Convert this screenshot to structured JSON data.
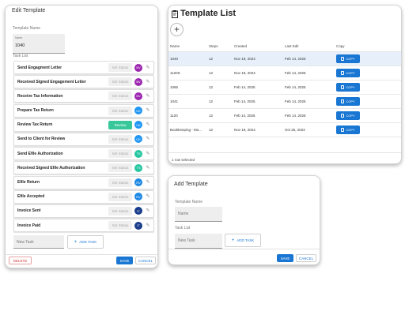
{
  "edit_template": {
    "title": "Edit Template",
    "template_name_label": "Template Name",
    "name_field_label": "Name",
    "name_value": "1040",
    "task_list_label": "Task List",
    "tasks": [
      {
        "name": "Send Engagment Letter",
        "status": "Set Status",
        "avatar": "BV",
        "color": "#9c27b0"
      },
      {
        "name": "Received Signed Engagement Letter",
        "status": "Set Status",
        "avatar": "BV",
        "color": "#9c27b0"
      },
      {
        "name": "Receive Tax Information",
        "status": "Set Status",
        "avatar": "BV",
        "color": "#9c27b0"
      },
      {
        "name": "Prepare Tax Return",
        "status": "Set Status",
        "avatar": "CK",
        "color": "#2196f3"
      },
      {
        "name": "Review Tax Return",
        "status": "Review",
        "avatar": "CK",
        "color": "#2196f3"
      },
      {
        "name": "Send to Client for Review",
        "status": "Set Status",
        "avatar": "CK",
        "color": "#2196f3"
      },
      {
        "name": "Send Efile Authorization",
        "status": "Set Status",
        "avatar": "TS",
        "color": "#26c6a0"
      },
      {
        "name": "Received Signed Efile Authorization",
        "status": "Set Status",
        "avatar": "TS",
        "color": "#26c6a0"
      },
      {
        "name": "Efile Return",
        "status": "Set Status",
        "avatar": "RV",
        "color": "#1e88e5"
      },
      {
        "name": "Efile Accepted",
        "status": "Set Status",
        "avatar": "RV",
        "color": "#1e88e5"
      },
      {
        "name": "Invoice Sent",
        "status": "Set Status",
        "avatar": "IT",
        "color": "#1a3e8c"
      },
      {
        "name": "Invoice Paid",
        "status": "Set Status",
        "avatar": "IT",
        "color": "#1a3e8c"
      }
    ],
    "new_task_placeholder": "New Task",
    "add_task_label": "ADD TASK",
    "delete_label": "DELETE",
    "save_label": "SAVE",
    "cancel_label": "CANCEL"
  },
  "template_list": {
    "title": "Template List",
    "columns": [
      "Name",
      "Steps",
      "Created",
      "Last Edit",
      "Copy"
    ],
    "rows": [
      {
        "name": "1040",
        "steps": "12",
        "created": "Nov 19, 2024",
        "last_edit": "Feb 14, 2025",
        "selected": true
      },
      {
        "name": "1120S",
        "steps": "12",
        "created": "Nov 19, 2024",
        "last_edit": "Feb 14, 2025",
        "selected": false
      },
      {
        "name": "1065",
        "steps": "12",
        "created": "Feb 14, 2025",
        "last_edit": "Feb 14, 2025",
        "selected": false
      },
      {
        "name": "1041",
        "steps": "12",
        "created": "Feb 14, 2025",
        "last_edit": "Feb 14, 2025",
        "selected": false
      },
      {
        "name": "1120",
        "steps": "12",
        "created": "Feb 14, 2025",
        "last_edit": "Feb 14, 2025",
        "selected": false
      },
      {
        "name": "Bookkeeping - Mo...",
        "steps": "12",
        "created": "Nov 19, 2024",
        "last_edit": "Oct 25, 2022",
        "selected": false
      }
    ],
    "copy_label": "COPY",
    "footer": "1 row selected",
    "accent": "#1976d2"
  },
  "add_template": {
    "title": "Add Template",
    "template_name_label": "Template Name",
    "name_placeholder": "Name",
    "task_list_label": "Task List",
    "new_task_placeholder": "New Task",
    "add_task_label": "ADD TASK",
    "save_label": "SAVE",
    "cancel_label": "CANCEL"
  }
}
